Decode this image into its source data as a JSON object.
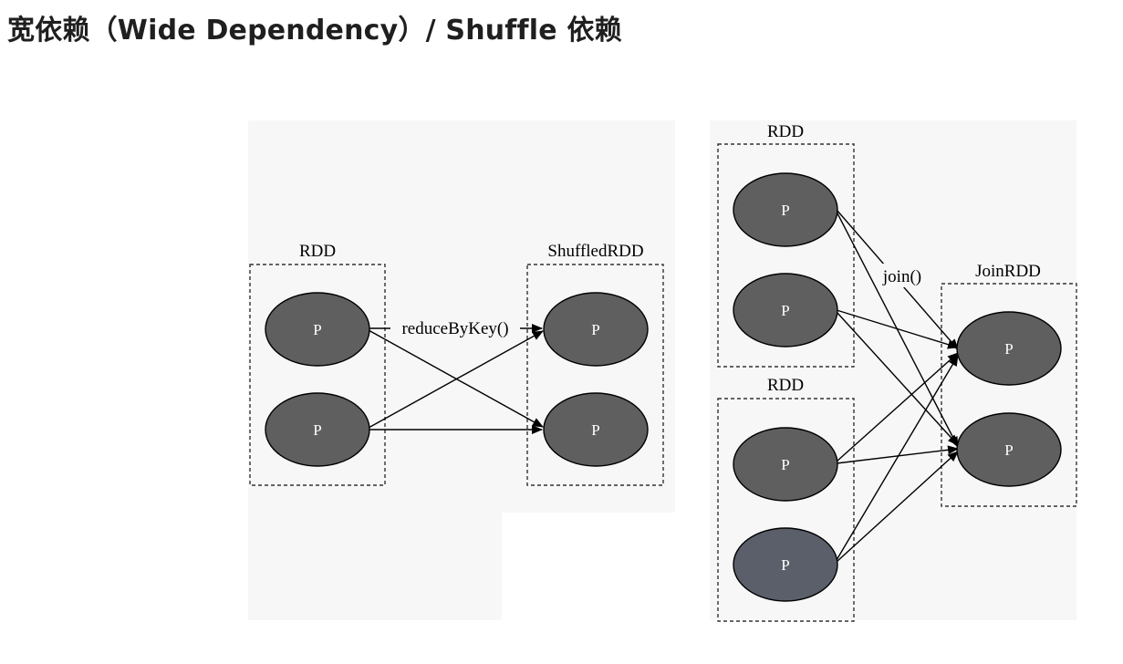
{
  "heading": "宽依赖（Wide Dependency）/ Shuffle 依赖",
  "colors": {
    "node_fill": "#5f5f5f",
    "node_fill_alt": "#5a5f6a",
    "diagram_background": "#f7f7f7",
    "box_stroke": "#333333"
  },
  "left_diagram": {
    "source_label": "RDD",
    "target_label": "ShuffledRDD",
    "operation_label": "reduceByKey()",
    "source_nodes": [
      "P",
      "P"
    ],
    "target_nodes": [
      "P",
      "P"
    ]
  },
  "right_diagram": {
    "source_top_label": "RDD",
    "source_bottom_label": "RDD",
    "target_label": "JoinRDD",
    "operation_label": "join()",
    "source_top_nodes": [
      "P",
      "P"
    ],
    "source_bottom_nodes": [
      "P",
      "P"
    ],
    "target_nodes": [
      "P",
      "P"
    ]
  }
}
